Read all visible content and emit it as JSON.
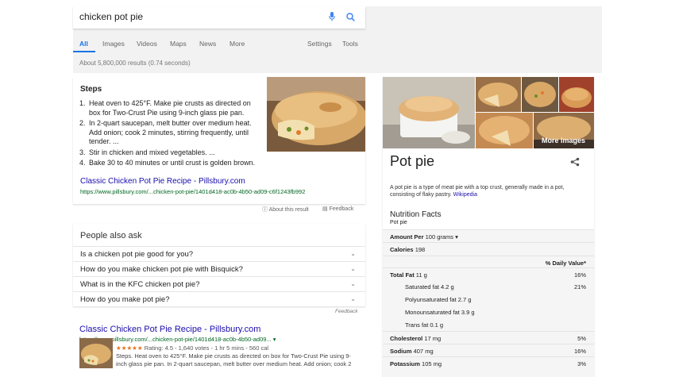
{
  "search": {
    "query": "chicken pot pie"
  },
  "tabs": [
    {
      "label": "All",
      "active": true
    },
    {
      "label": "Images",
      "active": false
    },
    {
      "label": "Videos",
      "active": false
    },
    {
      "label": "Maps",
      "active": false
    },
    {
      "label": "News",
      "active": false
    },
    {
      "label": "More",
      "active": false
    },
    {
      "label": "Settings",
      "active": false
    },
    {
      "label": "Tools",
      "active": false
    }
  ],
  "result_stats": "About 5,800,000 results (0.74 seconds)",
  "snippet": {
    "title": "Steps",
    "steps": [
      {
        "num": "1.",
        "text": "Heat oven to 425°F. Make pie crusts as directed on box for Two-Crust Pie using 9-inch glass pie pan."
      },
      {
        "num": "2.",
        "text": "In 2-quart saucepan, melt butter over medium heat. Add onion; cook 2 minutes, stirring frequently, until tender. ..."
      },
      {
        "num": "3.",
        "text": "Stir in chicken and mixed vegetables. ..."
      },
      {
        "num": "4.",
        "text": "Bake 30 to 40 minutes or until crust is golden brown."
      }
    ],
    "link": "Classic Chicken Pot Pie Recipe - Pillsbury.com",
    "url": "https://www.pillsbury.com/...chicken-pot-pie/1401d418-ac0b-4b50-ad09-c6f1243fb992",
    "about": "About this result",
    "feedback": "Feedback"
  },
  "paa": {
    "title": "People also ask",
    "questions": [
      "Is a chicken pot pie good for you?",
      "How do you make chicken pot pie with Bisquick?",
      "What is in the KFC chicken pot pie?",
      "How do you make pot pie?"
    ],
    "feedback": "Feedback"
  },
  "result2": {
    "title": "Classic Chicken Pot Pie Recipe - Pillsbury.com",
    "url": "https://www.pillsbury.com/...chicken-pot-pie/1401d418-ac0b-4b50-ad09...",
    "stars": "★★★★★",
    "rating": "Rating: 4.5 - 1,640 votes - 1 hr 5 mins - 560 cal",
    "desc": "Steps. Heat oven to 425°F. Make pie crusts as directed on box for Two-Crust Pie using 9-inch glass pie pan. In 2-quart saucepan, melt butter over medium heat. Add onion; cook 2"
  },
  "knowledge_panel": {
    "title": "Pot pie",
    "more_images": "More images",
    "description": "A pot pie is a type of meat pie with a top crust, generally made in a pot, consisting of flaky pastry.",
    "wiki": "Wikipedia",
    "nutrition_title": "Nutrition Facts",
    "nutrition_sub": "Pot pie",
    "amount_label": "Amount Per",
    "amount_value": "100 grams",
    "calories_label": "Calories",
    "calories_value": "198",
    "dv_header": "% Daily Value*",
    "rows": [
      {
        "label": "Total Fat",
        "amount": "11 g",
        "dv": "16%",
        "bold": true,
        "indent": false
      },
      {
        "label": "Saturated fat",
        "amount": "4.2 g",
        "dv": "21%",
        "bold": false,
        "indent": true
      },
      {
        "label": "Polyunsaturated fat",
        "amount": "2.7 g",
        "dv": "",
        "bold": false,
        "indent": true
      },
      {
        "label": "Monounsaturated fat",
        "amount": "3.9 g",
        "dv": "",
        "bold": false,
        "indent": true
      },
      {
        "label": "Trans fat",
        "amount": "0.1 g",
        "dv": "",
        "bold": false,
        "indent": true
      },
      {
        "label": "Cholesterol",
        "amount": "17 mg",
        "dv": "5%",
        "bold": true,
        "indent": false
      },
      {
        "label": "Sodium",
        "amount": "407 mg",
        "dv": "16%",
        "bold": true,
        "indent": false
      },
      {
        "label": "Potassium",
        "amount": "105 mg",
        "dv": "3%",
        "bold": true,
        "indent": false
      }
    ]
  },
  "colors": {
    "accent": "#1a73e8",
    "link": "#1a0dab",
    "url": "#006621",
    "stars": "#e7711b"
  }
}
